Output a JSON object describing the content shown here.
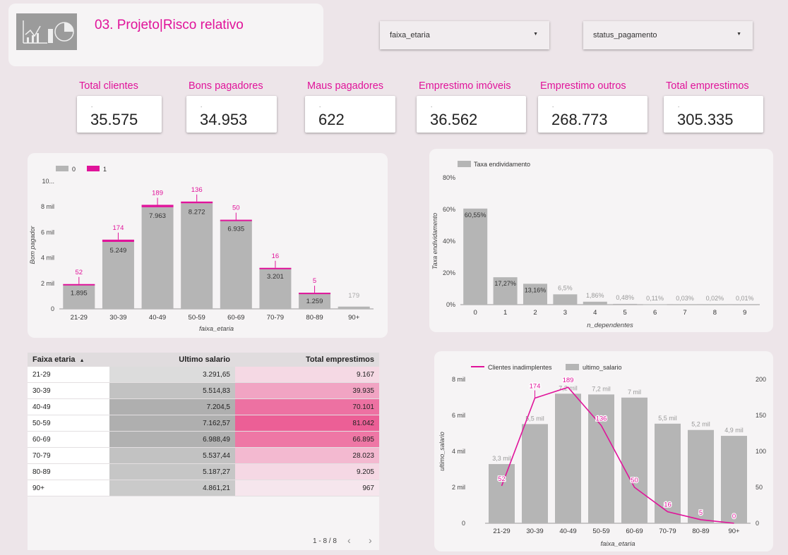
{
  "header": {
    "title": "03. Projeto|Risco relativo"
  },
  "filters": [
    {
      "label": "faixa_etaria"
    },
    {
      "label": "status_pagamento"
    }
  ],
  "kpis": [
    {
      "label": "Total clientes",
      "value": "35.575"
    },
    {
      "label": "Bons pagadores",
      "value": "34.953"
    },
    {
      "label": "Maus pagadores",
      "value": "622"
    },
    {
      "label": "Emprestimo imóveis",
      "value": "36.562"
    },
    {
      "label": "Emprestimo outros",
      "value": "268.773"
    },
    {
      "label": "Total emprestimos",
      "value": "305.335"
    }
  ],
  "colors": {
    "accent": "#e0139a",
    "bar_gray": "#b5b5b5",
    "background": "#ede5e9"
  },
  "chart_data": [
    {
      "type": "bar",
      "title": "",
      "xlabel": "faixa_etaria",
      "ylabel": "Bom pagador",
      "legend": [
        "0",
        "1"
      ],
      "legend_position": "top-left",
      "categories": [
        "21-29",
        "30-39",
        "40-49",
        "50-59",
        "60-69",
        "70-79",
        "80-89",
        "90+"
      ],
      "series": [
        {
          "name": "0",
          "values": [
            1895,
            5249,
            7963,
            8272,
            6935,
            3201,
            1259,
            179
          ],
          "labels": [
            "1.895",
            "5.249",
            "7.963",
            "8.272",
            "6.935",
            "3.201",
            "1.259",
            "179"
          ]
        },
        {
          "name": "1",
          "values": [
            52,
            174,
            189,
            136,
            50,
            16,
            5,
            0
          ],
          "labels": [
            "52",
            "174",
            "189",
            "136",
            "50",
            "16",
            "5",
            ""
          ]
        }
      ],
      "yticks": [
        "0",
        "2 mil",
        "4 mil",
        "6 mil",
        "8 mil",
        "10..."
      ],
      "ylim": [
        0,
        10000
      ],
      "stacked": true
    },
    {
      "type": "bar",
      "title": "",
      "xlabel": "n_dependentes",
      "ylabel": "Taxa endividamento",
      "legend": [
        "Taxa endividamento"
      ],
      "legend_position": "top-left",
      "categories": [
        "0",
        "1",
        "2",
        "3",
        "4",
        "5",
        "6",
        "7",
        "8",
        "9"
      ],
      "values": [
        60.55,
        17.27,
        13.16,
        6.5,
        1.86,
        0.48,
        0.11,
        0.03,
        0.02,
        0.01
      ],
      "labels": [
        "60,55%",
        "17,27%",
        "13,16%",
        "6,5%",
        "1,86%",
        "0,48%",
        "0,11%",
        "0,03%",
        "0,02%",
        "0,01%"
      ],
      "yticks": [
        "0%",
        "20%",
        "40%",
        "60%",
        "80%"
      ],
      "ylim": [
        0,
        80
      ]
    },
    {
      "type": "table",
      "columns": [
        "Faixa etaria",
        "Ultimo salario",
        "Total emprestimos"
      ],
      "sort_indicator": "▲",
      "rows": [
        {
          "faixa": "21-29",
          "salario": "3.291,65",
          "emprestimos": "9.167",
          "salario_v": 3291.65,
          "emprestimos_v": 9167
        },
        {
          "faixa": "30-39",
          "salario": "5.514,83",
          "emprestimos": "39.935",
          "salario_v": 5514.83,
          "emprestimos_v": 39935
        },
        {
          "faixa": "40-49",
          "salario": "7.204,5",
          "emprestimos": "70.101",
          "salario_v": 7204.5,
          "emprestimos_v": 70101
        },
        {
          "faixa": "50-59",
          "salario": "7.162,57",
          "emprestimos": "81.042",
          "salario_v": 7162.57,
          "emprestimos_v": 81042
        },
        {
          "faixa": "60-69",
          "salario": "6.988,49",
          "emprestimos": "66.895",
          "salario_v": 6988.49,
          "emprestimos_v": 66895
        },
        {
          "faixa": "70-79",
          "salario": "5.537,44",
          "emprestimos": "28.023",
          "salario_v": 5537.44,
          "emprestimos_v": 28023
        },
        {
          "faixa": "80-89",
          "salario": "5.187,27",
          "emprestimos": "9.205",
          "salario_v": 5187.27,
          "emprestimos_v": 9205
        },
        {
          "faixa": "90+",
          "salario": "4.861,21",
          "emprestimos": "967",
          "salario_v": 4861.21,
          "emprestimos_v": 967
        }
      ],
      "pagination": "1 - 8 / 8"
    },
    {
      "type": "bar",
      "title": "",
      "xlabel": "faixa_etaria",
      "ylabel": "ultimo_salario",
      "legend": [
        "Clientes inadimplentes",
        "ultimo_salario"
      ],
      "legend_position": "top-left",
      "categories": [
        "21-29",
        "30-39",
        "40-49",
        "50-59",
        "60-69",
        "70-79",
        "80-89",
        "90+"
      ],
      "bar_series": {
        "name": "ultimo_salario",
        "values": [
          3291.65,
          5514.83,
          7204.5,
          7162.57,
          6988.49,
          5537.44,
          5187.27,
          4861.21
        ],
        "labels": [
          "3,3 mil",
          "5,5 mil",
          "7,2 mil",
          "7,2 mil",
          "7 mil",
          "5,5 mil",
          "5,2 mil",
          "4,9 mil"
        ]
      },
      "line_series": {
        "name": "Clientes inadimplentes",
        "values": [
          52,
          174,
          189,
          136,
          50,
          16,
          5,
          0
        ],
        "labels": [
          "52",
          "174",
          "189",
          "136",
          "50",
          "16",
          "5",
          "0"
        ]
      },
      "yticks_left": [
        "0",
        "2 mil",
        "4 mil",
        "6 mil",
        "8 mil"
      ],
      "yticks_right": [
        "0",
        "50",
        "100",
        "150",
        "200"
      ],
      "ylim_left": [
        0,
        8000
      ],
      "ylim_right": [
        0,
        200
      ]
    }
  ]
}
